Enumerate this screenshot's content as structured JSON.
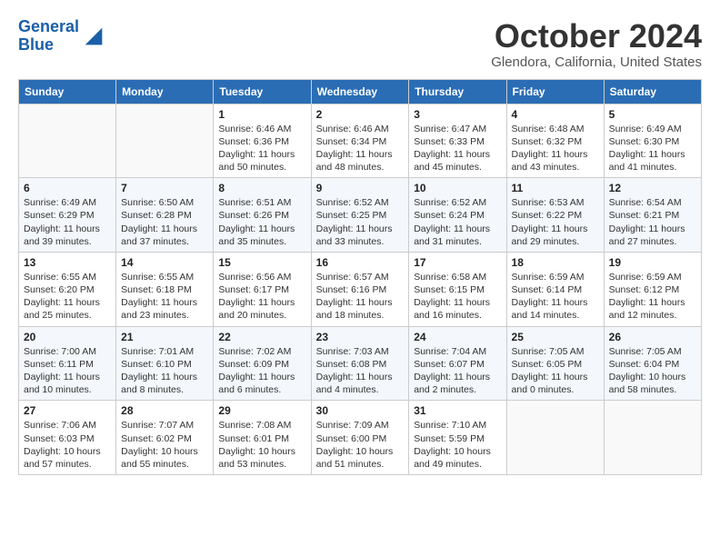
{
  "header": {
    "logo_line1": "General",
    "logo_line2": "Blue",
    "month": "October 2024",
    "location": "Glendora, California, United States"
  },
  "weekdays": [
    "Sunday",
    "Monday",
    "Tuesday",
    "Wednesday",
    "Thursday",
    "Friday",
    "Saturday"
  ],
  "weeks": [
    [
      {
        "day": "",
        "detail": ""
      },
      {
        "day": "",
        "detail": ""
      },
      {
        "day": "1",
        "detail": "Sunrise: 6:46 AM\nSunset: 6:36 PM\nDaylight: 11 hours and 50 minutes."
      },
      {
        "day": "2",
        "detail": "Sunrise: 6:46 AM\nSunset: 6:34 PM\nDaylight: 11 hours and 48 minutes."
      },
      {
        "day": "3",
        "detail": "Sunrise: 6:47 AM\nSunset: 6:33 PM\nDaylight: 11 hours and 45 minutes."
      },
      {
        "day": "4",
        "detail": "Sunrise: 6:48 AM\nSunset: 6:32 PM\nDaylight: 11 hours and 43 minutes."
      },
      {
        "day": "5",
        "detail": "Sunrise: 6:49 AM\nSunset: 6:30 PM\nDaylight: 11 hours and 41 minutes."
      }
    ],
    [
      {
        "day": "6",
        "detail": "Sunrise: 6:49 AM\nSunset: 6:29 PM\nDaylight: 11 hours and 39 minutes."
      },
      {
        "day": "7",
        "detail": "Sunrise: 6:50 AM\nSunset: 6:28 PM\nDaylight: 11 hours and 37 minutes."
      },
      {
        "day": "8",
        "detail": "Sunrise: 6:51 AM\nSunset: 6:26 PM\nDaylight: 11 hours and 35 minutes."
      },
      {
        "day": "9",
        "detail": "Sunrise: 6:52 AM\nSunset: 6:25 PM\nDaylight: 11 hours and 33 minutes."
      },
      {
        "day": "10",
        "detail": "Sunrise: 6:52 AM\nSunset: 6:24 PM\nDaylight: 11 hours and 31 minutes."
      },
      {
        "day": "11",
        "detail": "Sunrise: 6:53 AM\nSunset: 6:22 PM\nDaylight: 11 hours and 29 minutes."
      },
      {
        "day": "12",
        "detail": "Sunrise: 6:54 AM\nSunset: 6:21 PM\nDaylight: 11 hours and 27 minutes."
      }
    ],
    [
      {
        "day": "13",
        "detail": "Sunrise: 6:55 AM\nSunset: 6:20 PM\nDaylight: 11 hours and 25 minutes."
      },
      {
        "day": "14",
        "detail": "Sunrise: 6:55 AM\nSunset: 6:18 PM\nDaylight: 11 hours and 23 minutes."
      },
      {
        "day": "15",
        "detail": "Sunrise: 6:56 AM\nSunset: 6:17 PM\nDaylight: 11 hours and 20 minutes."
      },
      {
        "day": "16",
        "detail": "Sunrise: 6:57 AM\nSunset: 6:16 PM\nDaylight: 11 hours and 18 minutes."
      },
      {
        "day": "17",
        "detail": "Sunrise: 6:58 AM\nSunset: 6:15 PM\nDaylight: 11 hours and 16 minutes."
      },
      {
        "day": "18",
        "detail": "Sunrise: 6:59 AM\nSunset: 6:14 PM\nDaylight: 11 hours and 14 minutes."
      },
      {
        "day": "19",
        "detail": "Sunrise: 6:59 AM\nSunset: 6:12 PM\nDaylight: 11 hours and 12 minutes."
      }
    ],
    [
      {
        "day": "20",
        "detail": "Sunrise: 7:00 AM\nSunset: 6:11 PM\nDaylight: 11 hours and 10 minutes."
      },
      {
        "day": "21",
        "detail": "Sunrise: 7:01 AM\nSunset: 6:10 PM\nDaylight: 11 hours and 8 minutes."
      },
      {
        "day": "22",
        "detail": "Sunrise: 7:02 AM\nSunset: 6:09 PM\nDaylight: 11 hours and 6 minutes."
      },
      {
        "day": "23",
        "detail": "Sunrise: 7:03 AM\nSunset: 6:08 PM\nDaylight: 11 hours and 4 minutes."
      },
      {
        "day": "24",
        "detail": "Sunrise: 7:04 AM\nSunset: 6:07 PM\nDaylight: 11 hours and 2 minutes."
      },
      {
        "day": "25",
        "detail": "Sunrise: 7:05 AM\nSunset: 6:05 PM\nDaylight: 11 hours and 0 minutes."
      },
      {
        "day": "26",
        "detail": "Sunrise: 7:05 AM\nSunset: 6:04 PM\nDaylight: 10 hours and 58 minutes."
      }
    ],
    [
      {
        "day": "27",
        "detail": "Sunrise: 7:06 AM\nSunset: 6:03 PM\nDaylight: 10 hours and 57 minutes."
      },
      {
        "day": "28",
        "detail": "Sunrise: 7:07 AM\nSunset: 6:02 PM\nDaylight: 10 hours and 55 minutes."
      },
      {
        "day": "29",
        "detail": "Sunrise: 7:08 AM\nSunset: 6:01 PM\nDaylight: 10 hours and 53 minutes."
      },
      {
        "day": "30",
        "detail": "Sunrise: 7:09 AM\nSunset: 6:00 PM\nDaylight: 10 hours and 51 minutes."
      },
      {
        "day": "31",
        "detail": "Sunrise: 7:10 AM\nSunset: 5:59 PM\nDaylight: 10 hours and 49 minutes."
      },
      {
        "day": "",
        "detail": ""
      },
      {
        "day": "",
        "detail": ""
      }
    ]
  ]
}
